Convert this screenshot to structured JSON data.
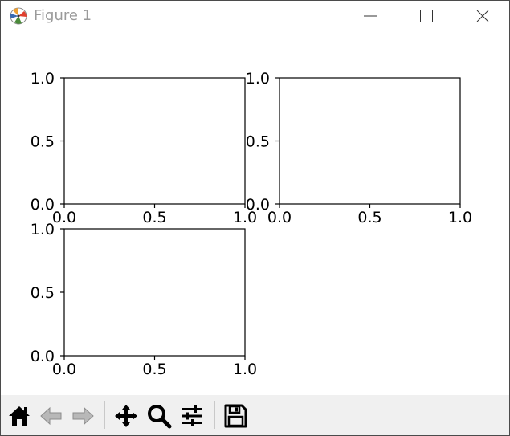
{
  "window": {
    "title": "Figure 1"
  },
  "chart_data": [
    {
      "type": "scatter",
      "title": "",
      "xlabel": "",
      "ylabel": "",
      "xlim": [
        0,
        1
      ],
      "ylim": [
        0,
        1
      ],
      "xticks": [
        "0.0",
        "0.5",
        "1.0"
      ],
      "yticks": [
        "0.0",
        "0.5",
        "1.0"
      ],
      "series": []
    },
    {
      "type": "scatter",
      "title": "",
      "xlabel": "",
      "ylabel": "",
      "xlim": [
        0,
        1
      ],
      "ylim": [
        0,
        1
      ],
      "xticks": [
        "0.0",
        "0.5",
        "1.0"
      ],
      "yticks": [
        "0.0",
        "0.5",
        "1.0"
      ],
      "series": []
    },
    {
      "type": "scatter",
      "title": "",
      "xlabel": "",
      "ylabel": "",
      "xlim": [
        0,
        1
      ],
      "ylim": [
        0,
        1
      ],
      "xticks": [
        "0.0",
        "0.5",
        "1.0"
      ],
      "yticks": [
        "0.0",
        "0.5",
        "1.0"
      ],
      "series": []
    }
  ],
  "toolbar": {
    "buttons": [
      {
        "name": "home-icon",
        "enabled": true
      },
      {
        "name": "back-icon",
        "enabled": false
      },
      {
        "name": "forward-icon",
        "enabled": false
      },
      {
        "name": "pan-icon",
        "enabled": true
      },
      {
        "name": "zoom-icon",
        "enabled": true
      },
      {
        "name": "configure-subplots-icon",
        "enabled": true
      },
      {
        "name": "save-icon",
        "enabled": true
      }
    ]
  }
}
